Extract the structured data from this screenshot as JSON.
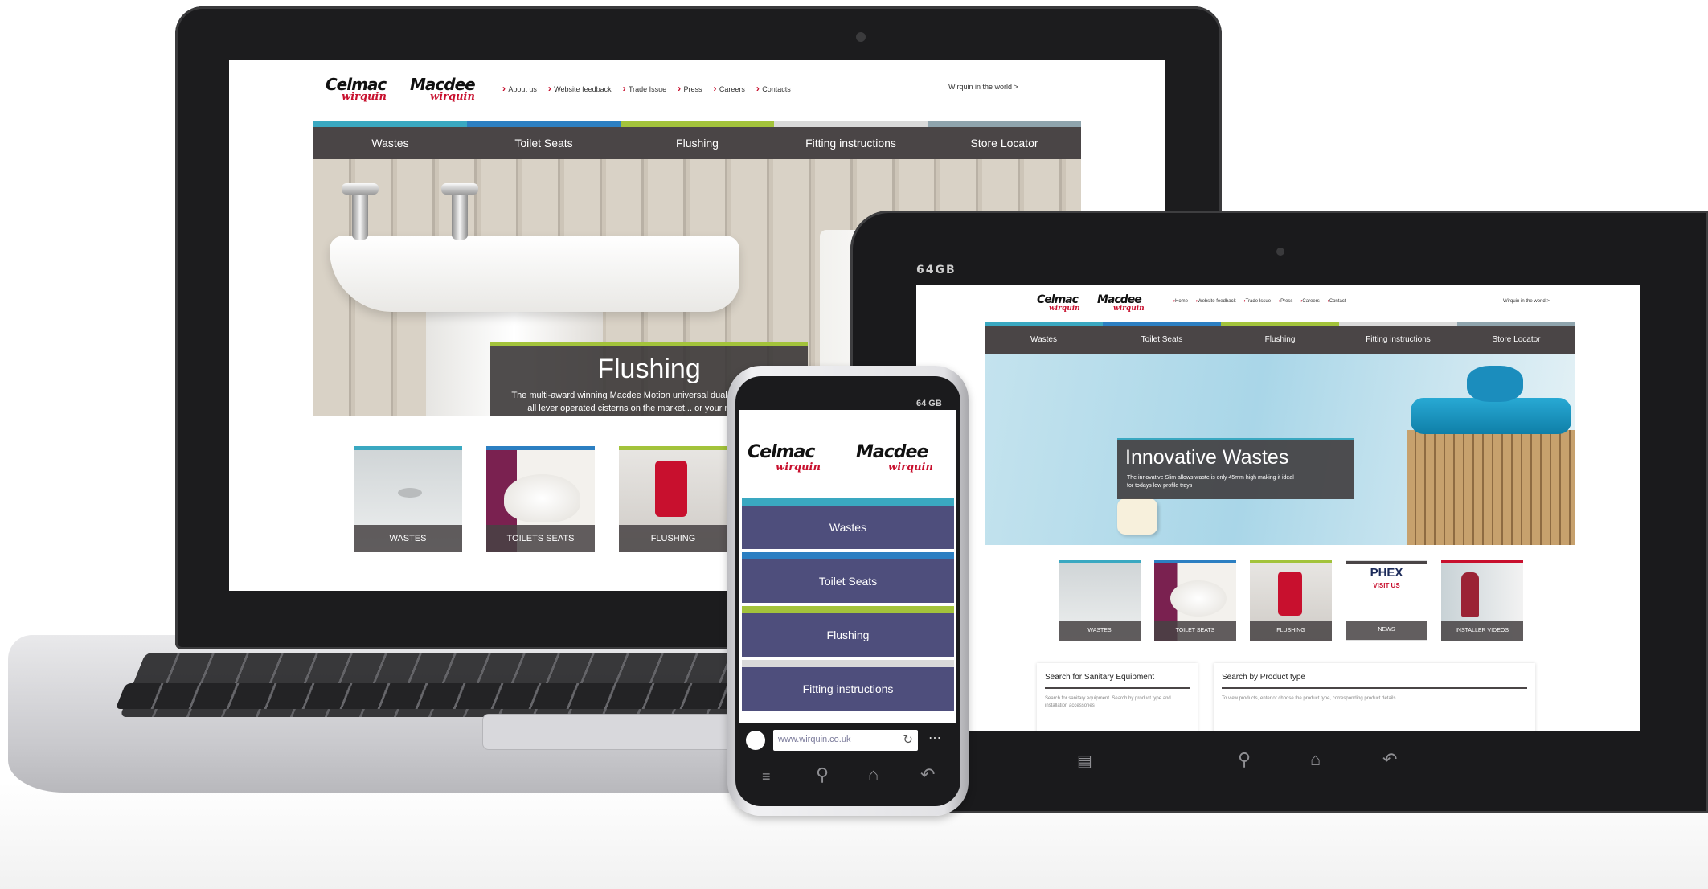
{
  "brand": {
    "logo_left": "Celmac",
    "logo_right": "Macdee",
    "sub_left": "wirquin",
    "sub_right": "wirquin",
    "colors": {
      "red": "#c8102e",
      "teal": "#3aa8c1",
      "blue": "#2c7fc2",
      "green": "#a3c33b",
      "grey": "#8fa4ad",
      "menu": "#4a4546"
    }
  },
  "laptop": {
    "nav": [
      "About us",
      "Website feedback",
      "Trade Issue",
      "Press",
      "Careers",
      "Contacts"
    ],
    "world_link": "Wirquin in the world  >",
    "menu": [
      "Wastes",
      "Toilet Seats",
      "Flushing",
      "Fitting instructions",
      "Store Locator"
    ],
    "hero": {
      "title": "Flushing",
      "text": "The multi-award winning Macdee Motion universal dual flush siphon fits all lever operated cisterns on the market... or your money back."
    },
    "tiles": [
      "WASTES",
      "TOILETS SEATS",
      "FLUSHING"
    ]
  },
  "tablet": {
    "storage_label": "64GB",
    "nav": [
      "Home",
      "Website feedback",
      "Trade Issue",
      "Press",
      "Careers",
      "Contact"
    ],
    "world_link": "Wirquin in the world  >",
    "menu": [
      "Wastes",
      "Toilet Seats",
      "Flushing",
      "Fitting instructions",
      "Store Locator"
    ],
    "hero": {
      "title": "Innovative Wastes",
      "text": "The innovative Slim allows waste is only 45mm high making it ideal for todays low profile trays"
    },
    "tiles": [
      "WASTES",
      "TOILET SEATS",
      "FLUSHING",
      "NEWS",
      "INSTALLER VIDEOS"
    ],
    "phex": {
      "title": "PHEX",
      "sub": "VISIT US"
    },
    "search_sanitary": {
      "title": "Search for Sanitary Equipment",
      "text": "Search for sanitary equipment. Search by product type and installation accessories"
    },
    "search_product": {
      "title": "Search by Product type",
      "text": "To view products, enter or choose the product type, corresponding product details"
    }
  },
  "phone": {
    "storage_label": "64 GB",
    "menu": [
      "Wastes",
      "Toilet Seats",
      "Flushing",
      "Fitting instructions"
    ],
    "url": "www.wirquin.co.uk"
  }
}
